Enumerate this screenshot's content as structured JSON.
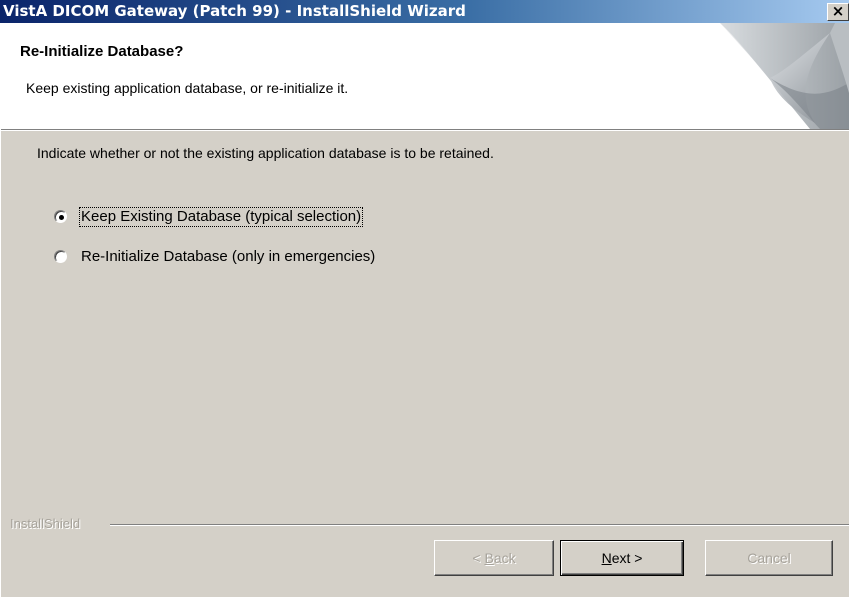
{
  "window": {
    "title": "VistA DICOM Gateway (Patch 99) - InstallShield Wizard",
    "close_glyph": "×"
  },
  "header": {
    "title": "Re-Initialize Database?",
    "subtitle": "Keep existing application database, or re-initialize it."
  },
  "body": {
    "instruction": "Indicate whether or not the existing application database is to be retained.",
    "options": [
      {
        "label": "Keep Existing Database (typical selection)",
        "selected": true
      },
      {
        "label": "Re-Initialize Database (only in emergencies)",
        "selected": false
      }
    ]
  },
  "footer": {
    "brand": "InstallShield",
    "back_prefix": "< ",
    "back_key": "B",
    "back_rest": "ack",
    "next_key": "N",
    "next_rest": "ext >",
    "cancel": "Cancel"
  },
  "colors": {
    "face": "#d4d0c8",
    "title_start": "#0a246a",
    "title_end": "#a6caf0",
    "disabled_text": "#a7a39b"
  },
  "icons": {
    "header_graphic": "installshield-page-curl-graphic",
    "close": "close-icon"
  }
}
